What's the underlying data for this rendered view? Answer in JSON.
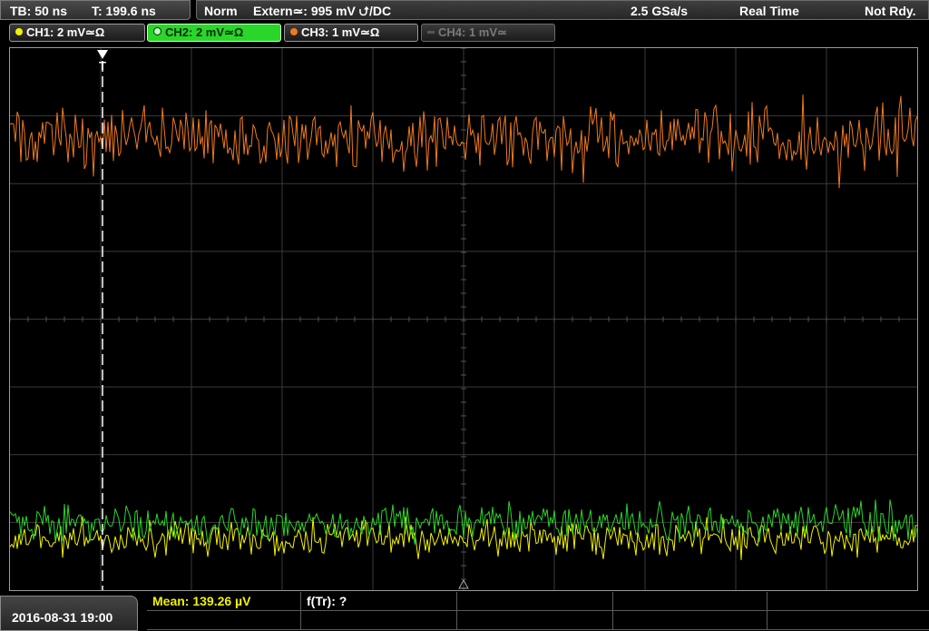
{
  "topbar": {
    "timebase": "TB: 50 ns",
    "trigger_time": "T: 199.6 ns",
    "mode": "Norm",
    "trigger_source": "Extern≃: 995 mV ⮍/DC",
    "sample_rate": "2.5 GSa/s",
    "acq_mode": "Real Time",
    "status": "Not Rdy."
  },
  "channels": [
    {
      "label": "CH1: 2 mV≃Ω",
      "color": "#f2f200"
    },
    {
      "label": "CH2: 2 mV≃Ω",
      "color": "#29d629"
    },
    {
      "label": "CH3: 1 mV≃Ω",
      "color": "#f07a1e"
    },
    {
      "label": "CH4: 1 mV≃",
      "color": "#7a7a7a"
    }
  ],
  "trigger_marker": "T",
  "bottom": {
    "datetime": "2016-08-31 19:00",
    "measurements": {
      "mean": "Mean: 139.26 µV",
      "ftr": "f(Tr): ?"
    }
  },
  "colors": {
    "ch1": "#f2f200",
    "ch2": "#29d629",
    "ch3": "#f07a1e",
    "grid": "#3a3a3a"
  }
}
